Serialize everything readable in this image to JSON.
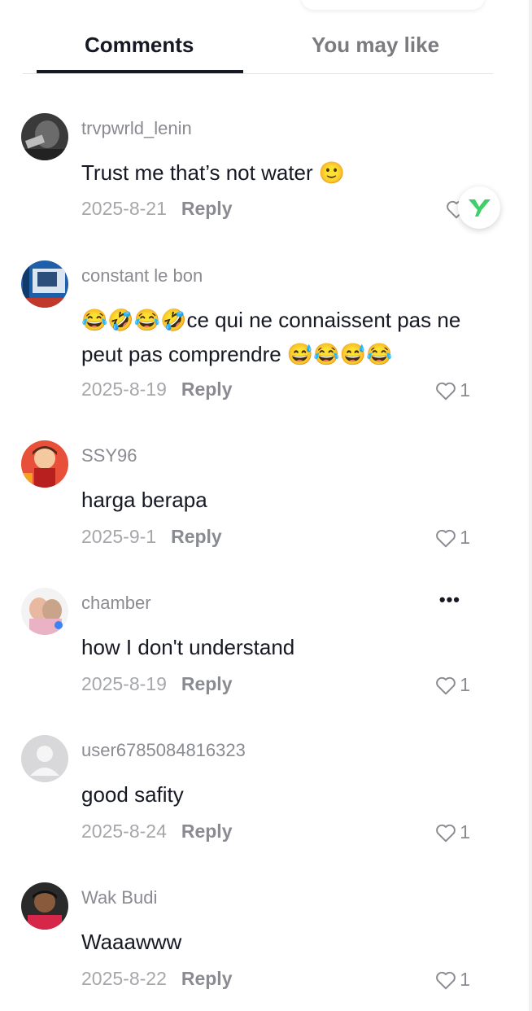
{
  "tabs": [
    {
      "label": "Comments",
      "active": true
    },
    {
      "label": "You may like",
      "active": false
    }
  ],
  "comments": [
    {
      "username": "trvpwrld_lenin",
      "text": "Trust me that’s not water 🙂",
      "date": "2025-8-21",
      "reply": "Reply",
      "likes": ""
    },
    {
      "username": "constant le bon",
      "text": "😂🤣😂🤣ce qui ne connaissent pas ne peut pas comprendre 😅😂😅😂",
      "date": "2025-8-19",
      "reply": "Reply",
      "likes": "1"
    },
    {
      "username": "SSY96",
      "text": "harga berapa",
      "date": "2025-9-1",
      "reply": "Reply",
      "likes": "1"
    },
    {
      "username": "chamber",
      "text": "how I don't understand",
      "date": "2025-8-19",
      "reply": "Reply",
      "likes": "1"
    },
    {
      "username": "user6785084816323",
      "text": "good safity",
      "date": "2025-8-24",
      "reply": "Reply",
      "likes": "1"
    },
    {
      "username": "Wak Budi",
      "text": "Waaawww",
      "date": "2025-8-22",
      "reply": "Reply",
      "likes": "1"
    }
  ],
  "more_options": "•••",
  "colors": {
    "primary_text": "#161823",
    "secondary_text": "#8a8b91",
    "accent_green": "#3ccf6a"
  },
  "icons": {
    "like": "heart-outline-icon",
    "fab": "green-y-logo-icon"
  }
}
